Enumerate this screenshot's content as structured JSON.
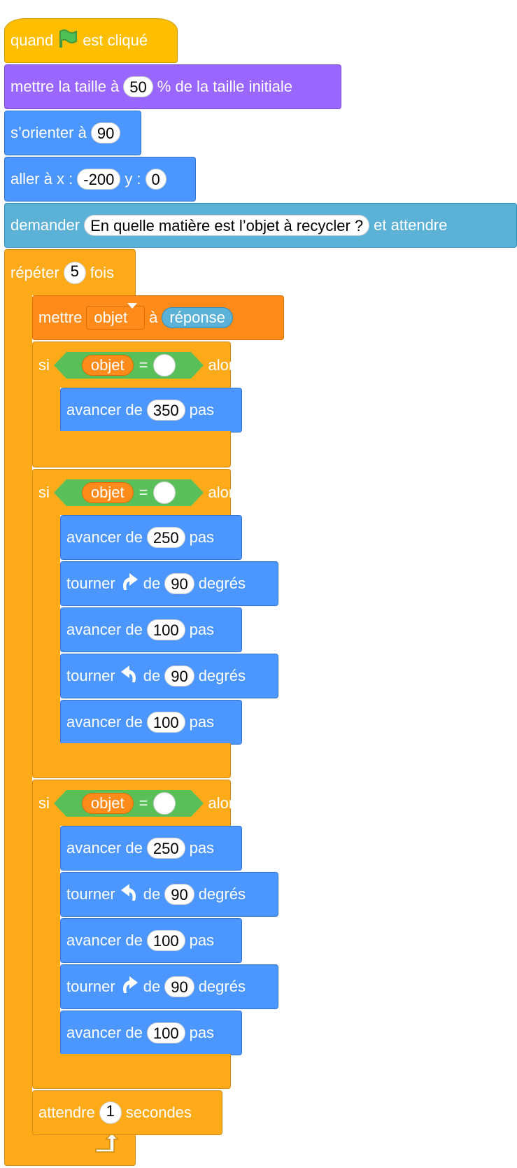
{
  "blocks": {
    "when_flag": {
      "before": "quand",
      "after": "est cliqué"
    },
    "set_size": {
      "before": "mettre la taille à",
      "value": "50",
      "after": "% de la taille initiale"
    },
    "point_dir": {
      "before": "s’orienter à",
      "value": "90"
    },
    "goto": {
      "before": "aller à x :",
      "x": "-200",
      "mid": "y :",
      "y": "0"
    },
    "ask": {
      "before": "demander",
      "question": "En quelle matière est l’objet à recycler ?",
      "after": "et attendre"
    },
    "repeat": {
      "before": "répéter",
      "count": "5",
      "after": "fois"
    },
    "set_var": {
      "before": "mettre",
      "var": "objet",
      "mid": "à",
      "reporter": "réponse"
    },
    "if1": {
      "si": "si",
      "var": "objet",
      "eq": "=",
      "alors": "alors",
      "body": [
        {
          "before": "avancer de",
          "value": "350",
          "after": "pas"
        }
      ]
    },
    "if2": {
      "si": "si",
      "var": "objet",
      "eq": "=",
      "alors": "alors",
      "body": [
        {
          "before": "avancer de",
          "value": "250",
          "after": "pas"
        },
        {
          "before": "tourner",
          "dir": "right",
          "mid": "de",
          "value": "90",
          "after": "degrés"
        },
        {
          "before": "avancer de",
          "value": "100",
          "after": "pas"
        },
        {
          "before": "tourner",
          "dir": "left",
          "mid": "de",
          "value": "90",
          "after": "degrés"
        },
        {
          "before": "avancer de",
          "value": "100",
          "after": "pas"
        }
      ]
    },
    "if3": {
      "si": "si",
      "var": "objet",
      "eq": "=",
      "alors": "alors",
      "body": [
        {
          "before": "avancer de",
          "value": "250",
          "after": "pas"
        },
        {
          "before": "tourner",
          "dir": "left",
          "mid": "de",
          "value": "90",
          "after": "degrés"
        },
        {
          "before": "avancer de",
          "value": "100",
          "after": "pas"
        },
        {
          "before": "tourner",
          "dir": "right",
          "mid": "de",
          "value": "90",
          "after": "degrés"
        },
        {
          "before": "avancer de",
          "value": "100",
          "after": "pas"
        }
      ]
    },
    "wait": {
      "before": "attendre",
      "value": "1",
      "after": "secondes"
    }
  },
  "icons": {
    "flag": "green-flag-icon",
    "turn_right": "turn-right-icon",
    "turn_left": "turn-left-icon",
    "loop_arrow": "repeat-arrow-icon"
  },
  "colors": {
    "events": "#ffbf00",
    "looks": "#9966ff",
    "motion": "#4c97ff",
    "sensing": "#5cb1d6",
    "control": "#ffab19",
    "variables": "#ff8c1a",
    "operators": "#59c059"
  }
}
